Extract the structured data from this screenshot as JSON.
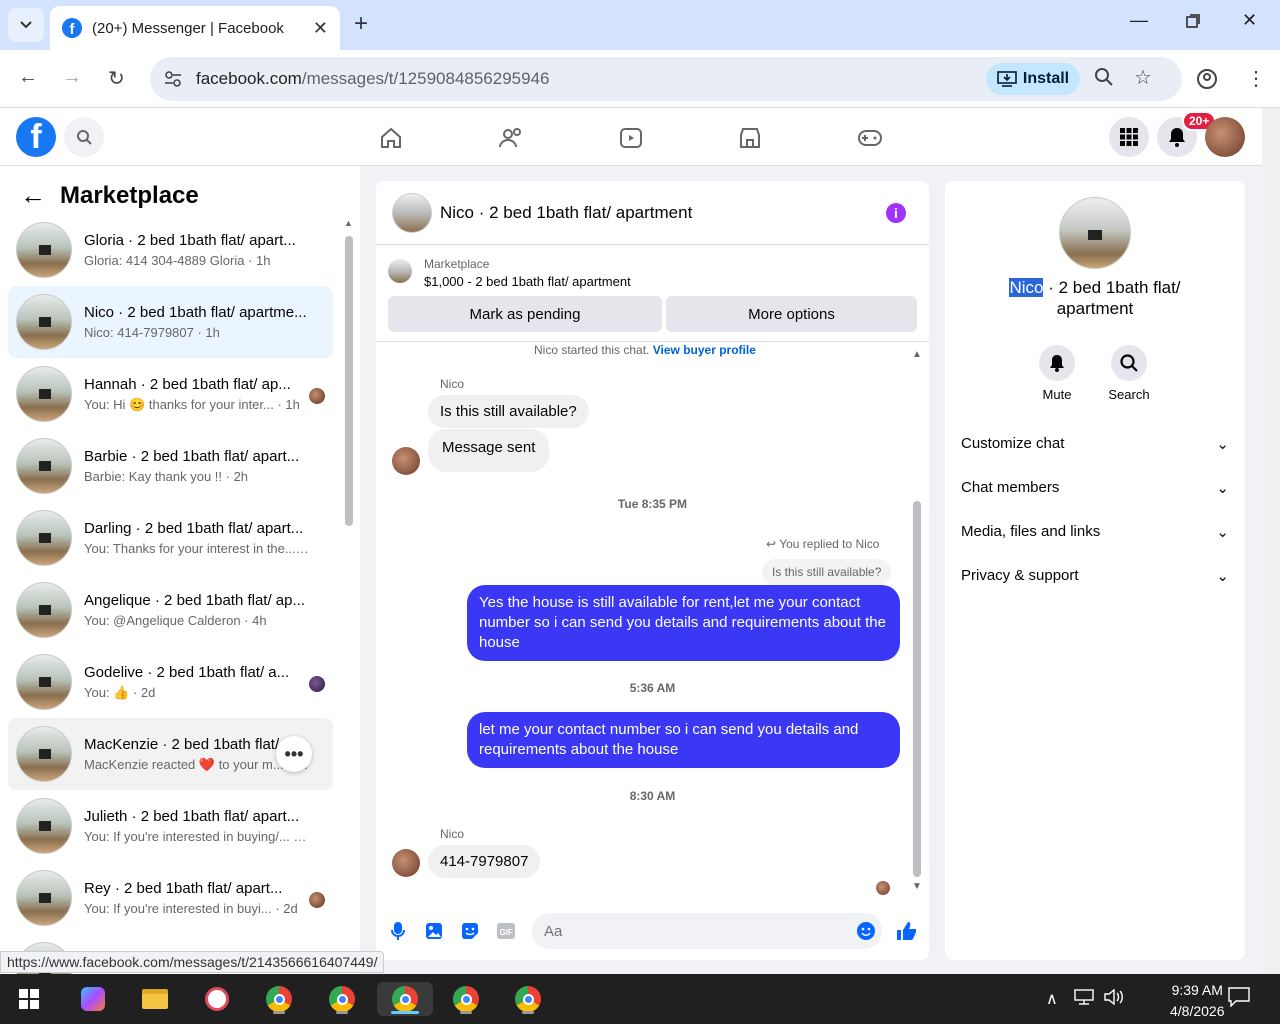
{
  "browser": {
    "tab_title": "(20+) Messenger | Facebook",
    "url_host": "facebook.com",
    "url_path": "/messages/t/1259084856295946",
    "install_label": "Install"
  },
  "header": {
    "notification_badge": "20+"
  },
  "left": {
    "title": "Marketplace",
    "chats": [
      {
        "name": "Gloria · 2 bed 1bath flat/ apart...",
        "sub": "Gloria: 414 304-4889 Gloria · 1h"
      },
      {
        "name": "Nico · 2 bed 1bath flat/ apartme...",
        "sub": "Nico: 414-7979807 · 1h"
      },
      {
        "name": "Hannah · 2 bed 1bath flat/ ap...",
        "sub": "You: Hi 😊 thanks for your inter... · 1h"
      },
      {
        "name": "Barbie · 2 bed 1bath flat/ apart...",
        "sub": "Barbie: Kay thank you !! · 2h"
      },
      {
        "name": "Darling · 2 bed 1bath flat/ apart...",
        "sub": "You: Thanks for your interest in the... · 3h"
      },
      {
        "name": "Angelique · 2 bed 1bath flat/ ap...",
        "sub": "You: @Angelique Calderon · 4h"
      },
      {
        "name": "Godelive · 2 bed 1bath flat/ a...",
        "sub": "You: 👍 · 2d"
      },
      {
        "name": "MacKenzie · 2 bed 1bath flat/",
        "sub": "MacKenzie reacted ❤️ to your m... · 2d"
      },
      {
        "name": "Julieth · 2 bed 1bath flat/ apart...",
        "sub": "You: If you're interested in buying/... · 2d"
      },
      {
        "name": "Rey · 2 bed 1bath flat/ apart...",
        "sub": "You: If you're interested in buyi... · 2d"
      }
    ]
  },
  "chat": {
    "title": "Nico · 2 bed 1bath flat/ apartment",
    "marketplace_label": "Marketplace",
    "listing": "$1,000 - 2 bed 1bath flat/ apartment",
    "mark_pending": "Mark as pending",
    "more_options": "More options",
    "started": "Nico started this chat.",
    "view_profile": "View buyer profile",
    "sender1": "Nico",
    "msg1": "Is this still available?",
    "msg2": "Message sent",
    "ts1": "Tue 8:35 PM",
    "replied": "You replied to Nico",
    "quote": "Is this still available?",
    "out1": "Yes the house is still available for rent,let me your contact number so i can send you details and requirements about the house",
    "ts2": "5:36 AM",
    "out2": "let me your contact number so i can send you details and requirements about the house",
    "ts3": "8:30 AM",
    "sender2": "Nico",
    "msg3": "414-7979807",
    "composer_placeholder": "Aa"
  },
  "right": {
    "name_highlight": "Nico",
    "name_rest": " · 2 bed 1bath flat/ apartment",
    "mute": "Mute",
    "search": "Search",
    "sections": [
      "Customize chat",
      "Chat members",
      "Media, files and links",
      "Privacy & support"
    ]
  },
  "status_url": "https://www.facebook.com/messages/t/2143566616407449/",
  "taskbar": {
    "time": "9:39 AM",
    "date": "4/8/2026"
  }
}
